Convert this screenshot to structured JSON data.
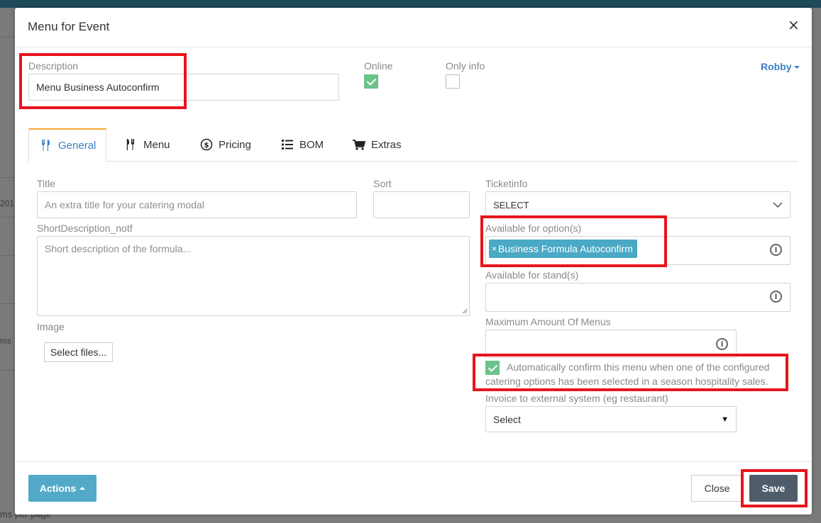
{
  "background": {
    "left_text_1": "201",
    "left_text_2": "ms",
    "bottom_text": "ms per page"
  },
  "modal": {
    "title": "Menu for Event",
    "close_icon": "×"
  },
  "description": {
    "label": "Description",
    "value": "Menu Business Autoconfirm"
  },
  "online": {
    "label": "Online",
    "checked": true
  },
  "only_info": {
    "label": "Only info",
    "checked": false
  },
  "user": {
    "name": "Robby"
  },
  "tabs": [
    {
      "label": "General",
      "icon": "fork-knife-icon",
      "active": true
    },
    {
      "label": "Menu",
      "icon": "fork-knife-icon",
      "active": false
    },
    {
      "label": "Pricing",
      "icon": "dollar-circle-icon",
      "active": false
    },
    {
      "label": "BOM",
      "icon": "list-icon",
      "active": false
    },
    {
      "label": "Extras",
      "icon": "cart-icon",
      "active": false
    }
  ],
  "general": {
    "title_label": "Title",
    "title_placeholder": "An extra title for your catering modal",
    "sort_label": "Sort",
    "sort_value": "",
    "short_desc_label": "ShortDescription_notf",
    "short_desc_placeholder": "Short description of the formula...",
    "image_label": "Image",
    "select_files_label": "Select files...",
    "ticketinfo_label": "Ticketinfo",
    "ticketinfo_value": "SELECT",
    "available_options_label": "Available for option(s)",
    "available_options_tags": [
      "Business Formula Autoconfirm"
    ],
    "available_stands_label": "Available for stand(s)",
    "max_menus_label": "Maximum Amount Of Menus",
    "max_menus_value": "",
    "auto_confirm_text": "Automatically confirm this menu when one of the configured catering options has been selected in a season hospitality sales.",
    "auto_confirm_checked": true,
    "invoice_label": "Invoice to external system (eg restaurant)",
    "invoice_value": "Select"
  },
  "footer": {
    "actions_label": "Actions",
    "close_label": "Close",
    "save_label": "Save"
  },
  "colors": {
    "accent": "#3b7fc4",
    "tab_top": "#f0a830",
    "check_on": "#6cc28b",
    "tag_bg": "#4aa9c5",
    "actions_bg": "#53a9c8",
    "save_bg": "#4f5d6b",
    "highlight": "#e8141b"
  }
}
